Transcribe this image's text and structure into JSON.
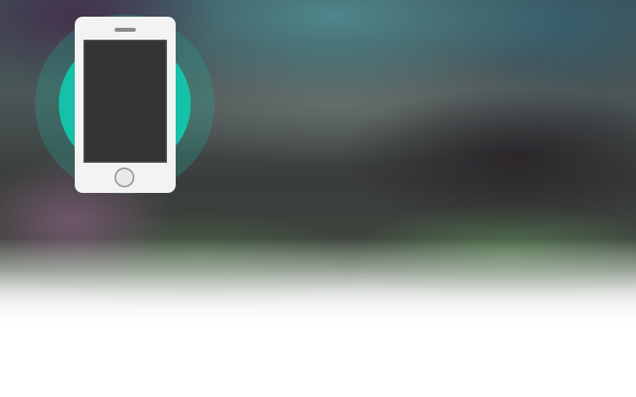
{
  "hero": {
    "background": "blurred-photo",
    "illustration_icon": "smartphone-icon",
    "colors": {
      "accent_circle": "#15c1a9",
      "halo": "#2aa996",
      "phone_body": "#f3f3f3",
      "phone_screen": "#333333"
    }
  }
}
